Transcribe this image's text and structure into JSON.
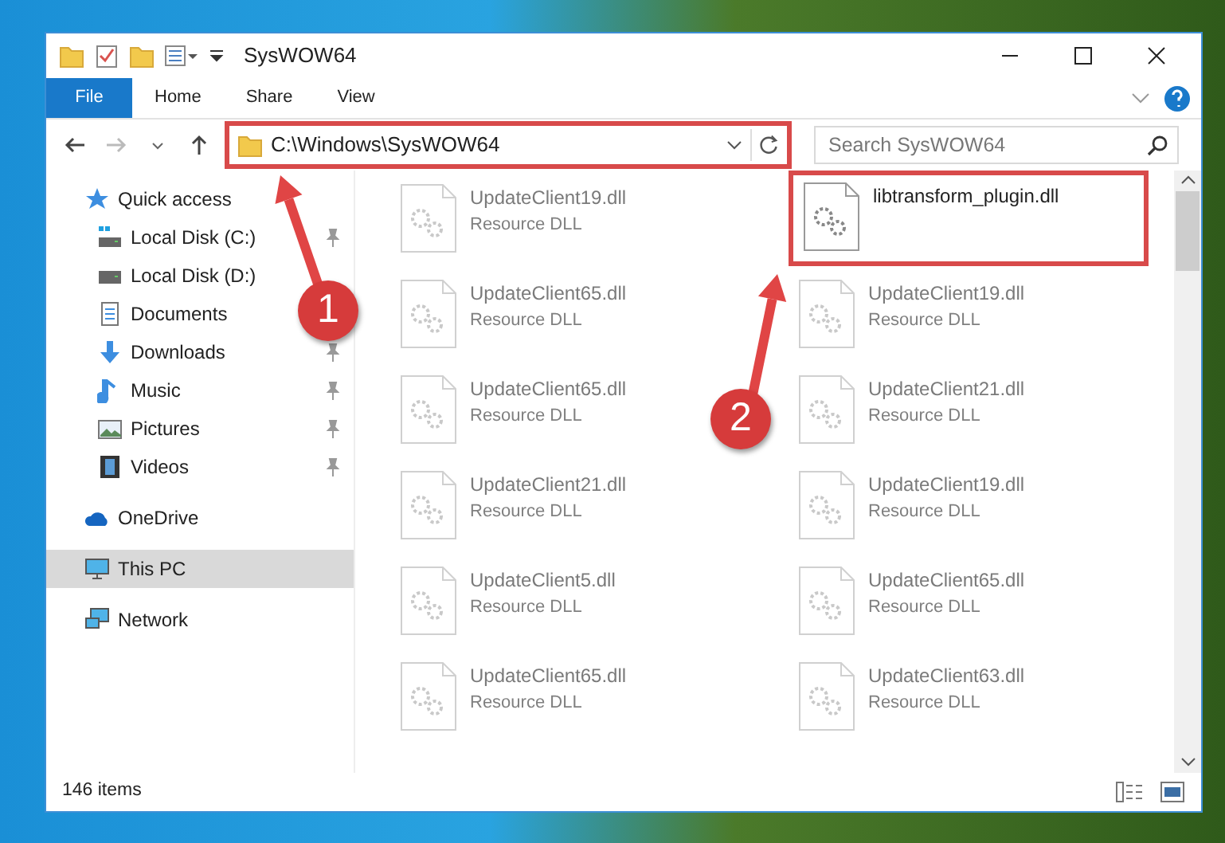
{
  "window": {
    "title": "SysWOW64"
  },
  "ribbon_tabs": [
    {
      "label": "File",
      "kind": "file"
    },
    {
      "label": "Home",
      "kind": "tab"
    },
    {
      "label": "Share",
      "kind": "tab"
    },
    {
      "label": "View",
      "kind": "tab"
    }
  ],
  "address_bar": {
    "path": "C:\\Windows\\SysWOW64"
  },
  "search": {
    "placeholder": "Search SysWOW64"
  },
  "sidebar": {
    "items": [
      {
        "label": "Quick access",
        "selected": false,
        "children": [
          {
            "label": "Local Disk (C:)",
            "pinned": true
          },
          {
            "label": "Local Disk (D:)",
            "pinned": false
          },
          {
            "label": "Documents",
            "pinned": false
          },
          {
            "label": "Downloads",
            "pinned": true
          },
          {
            "label": "Music",
            "pinned": true
          },
          {
            "label": "Pictures",
            "pinned": true
          },
          {
            "label": "Videos",
            "pinned": true
          }
        ]
      },
      {
        "label": "OneDrive",
        "selected": false
      },
      {
        "label": "This PC",
        "selected": true
      },
      {
        "label": "Network",
        "selected": false
      }
    ]
  },
  "files": [
    {
      "name": "UpdateClient19.dll",
      "type": "Resource DLL",
      "faded": true
    },
    {
      "name": "libtransform_plugin.dll",
      "faded": false
    },
    {
      "name": "UpdateClient65.dll",
      "type": "Resource DLL",
      "faded": true
    },
    {
      "name": "UpdateClient19.dll",
      "type": "Resource DLL",
      "faded": true
    },
    {
      "name": "UpdateClient65.dll",
      "type": "Resource DLL",
      "faded": true
    },
    {
      "name": "UpdateClient21.dll",
      "type": "Resource DLL",
      "faded": true
    },
    {
      "name": "UpdateClient21.dll",
      "type": "Resource DLL",
      "faded": true
    },
    {
      "name": "UpdateClient19.dll",
      "type": "Resource DLL",
      "faded": true
    },
    {
      "name": "UpdateClient5.dll",
      "type": "Resource DLL",
      "faded": true
    },
    {
      "name": "UpdateClient65.dll",
      "type": "Resource DLL",
      "faded": true
    },
    {
      "name": "UpdateClient65.dll",
      "type": "Resource DLL",
      "faded": true
    },
    {
      "name": "UpdateClient63.dll",
      "type": "Resource DLL",
      "faded": true
    }
  ],
  "status_bar": {
    "text": "146 items"
  },
  "annotations": [
    {
      "label": "1"
    },
    {
      "label": "2"
    }
  ]
}
